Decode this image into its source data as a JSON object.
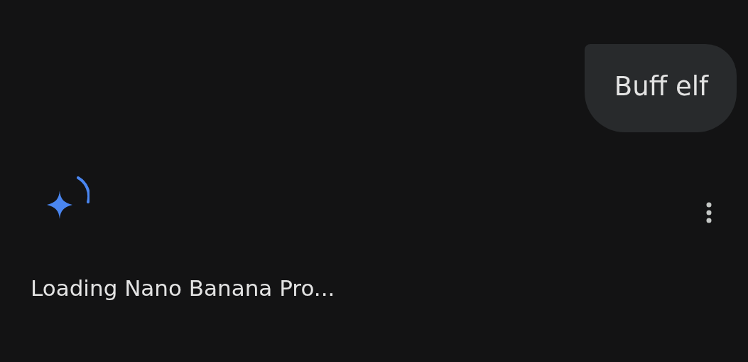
{
  "user_message": {
    "text": "Buff elf"
  },
  "response": {
    "status": "Loading Nano Banana Pro..."
  }
}
